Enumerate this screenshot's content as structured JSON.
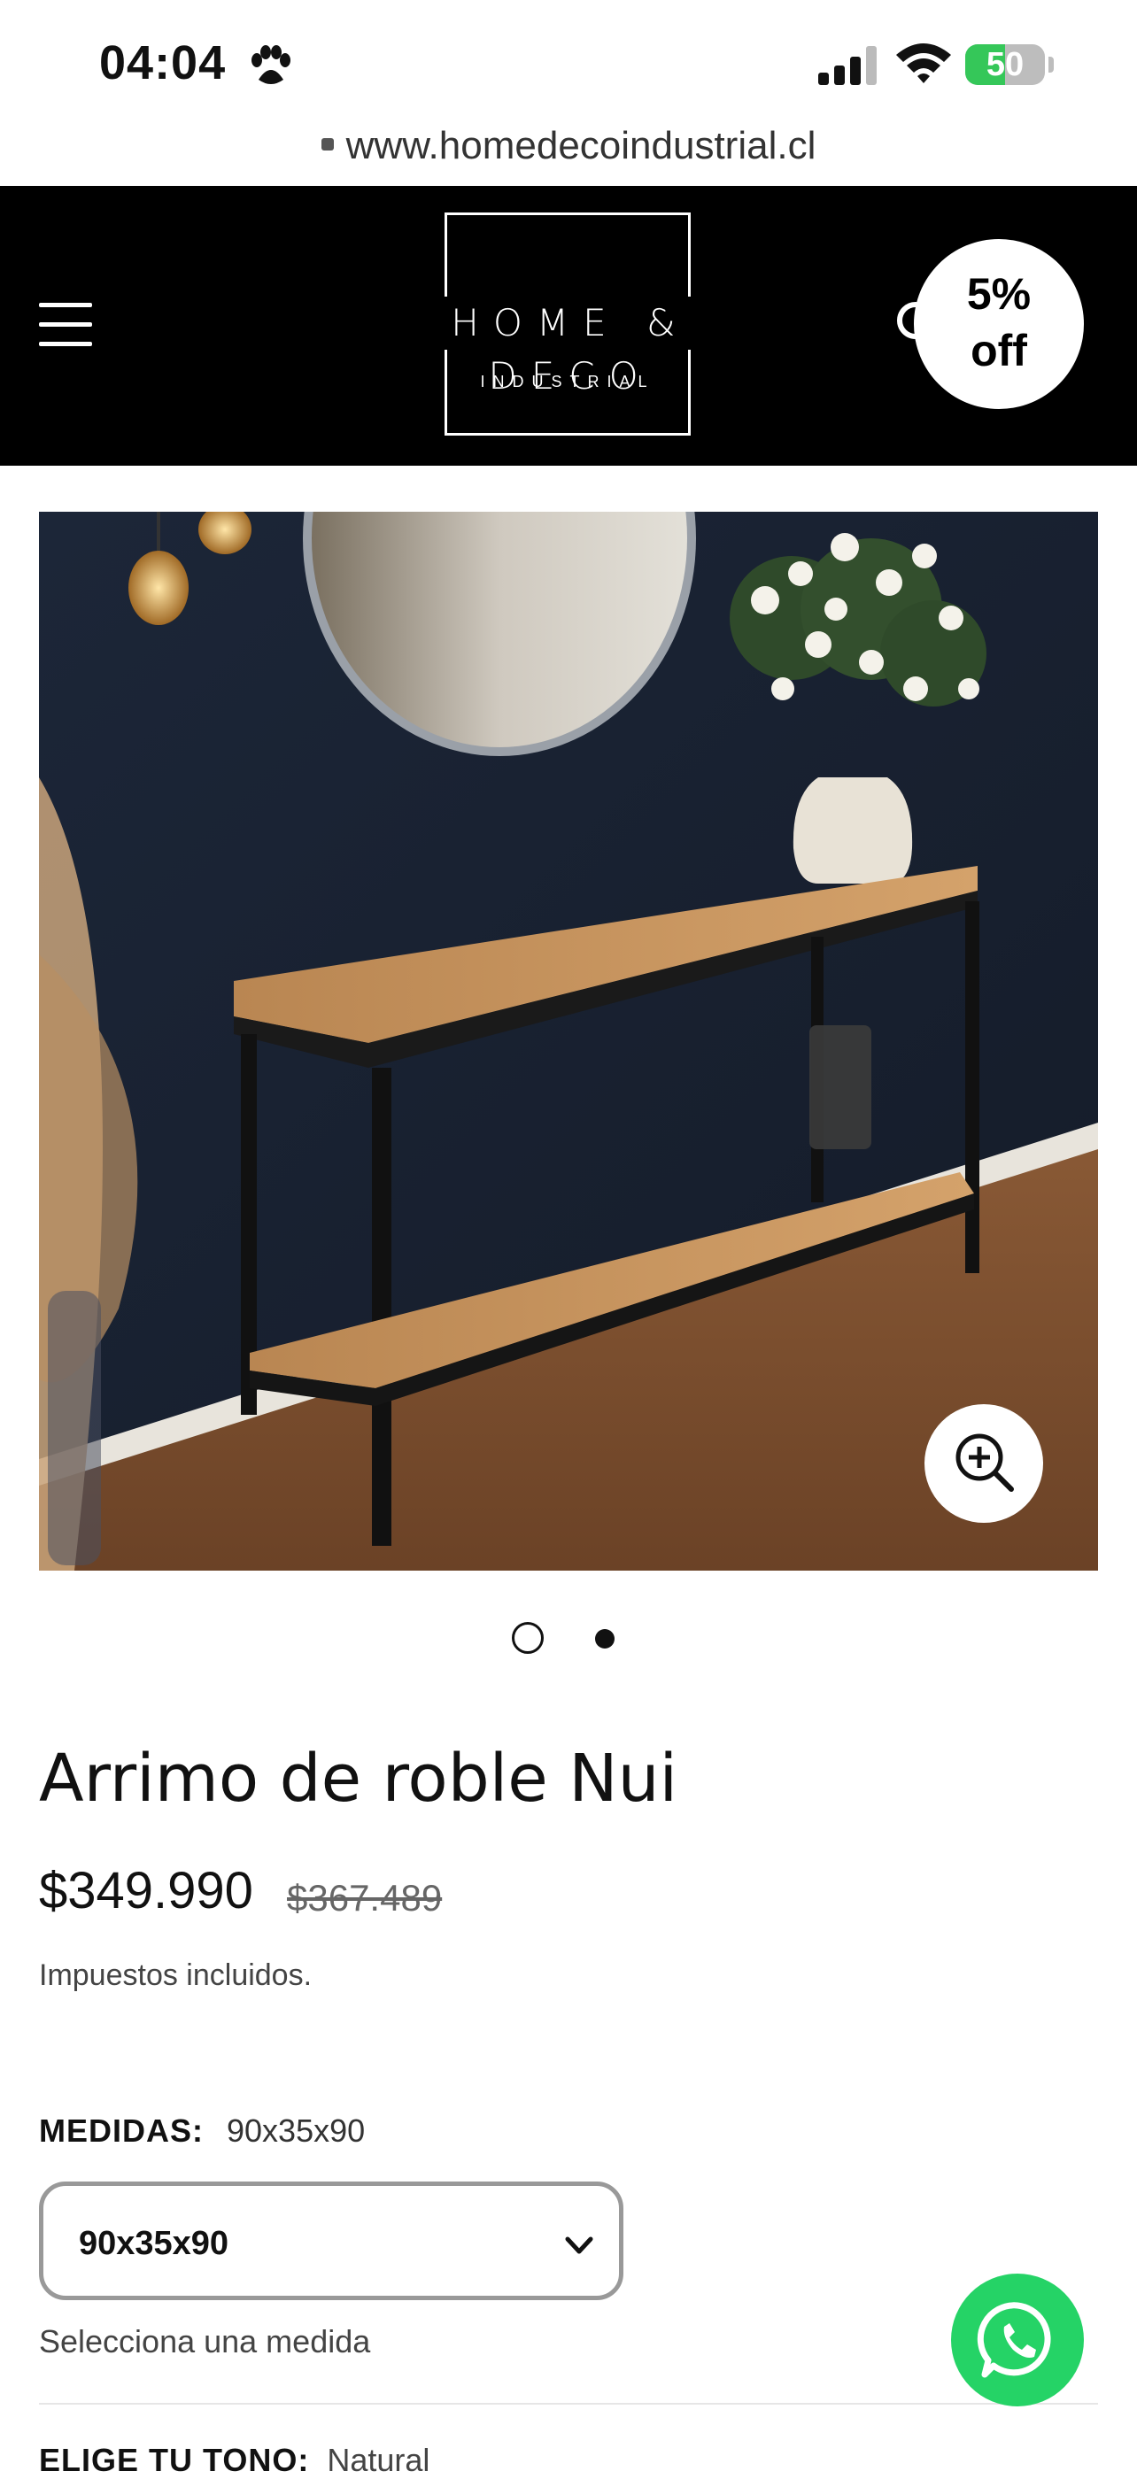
{
  "status_bar": {
    "time": "04:04",
    "battery": "50"
  },
  "browser": {
    "url": "www.homedecoindustrial.cl"
  },
  "header": {
    "logo_main": "HOME & DECO",
    "logo_sub": "INDUSTRIAL",
    "discount_line1": "5%",
    "discount_line2": "off"
  },
  "gallery": {
    "image_count": 2,
    "active_index": 1
  },
  "product": {
    "title": "Arrimo de roble Nui",
    "price": "$349.990",
    "compare_price": "$367.489",
    "tax_note": "Impuestos incluidos.",
    "medidas_label": "MEDIDAS:",
    "medidas_value": "90x35x90",
    "select_value": "90x35x90",
    "select_helper": "Selecciona una medida",
    "next_option_label": "ELIGE TU TONO:",
    "next_option_value": "Natural"
  },
  "colors": {
    "header_bg": "#000000",
    "whatsapp": "#25d366",
    "battery_fill": "#35c759"
  }
}
